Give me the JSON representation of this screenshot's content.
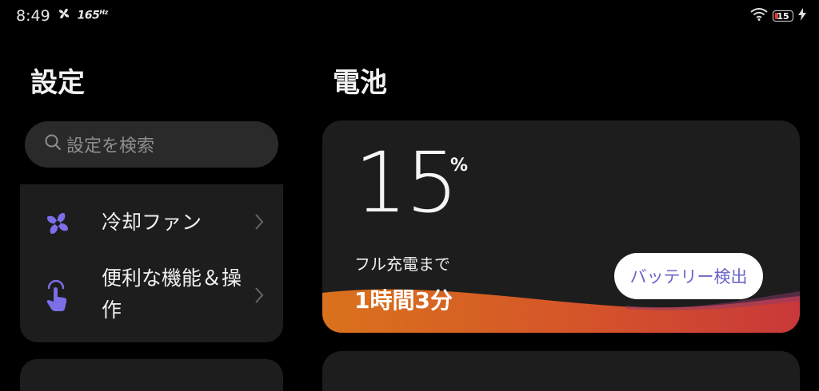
{
  "status_bar": {
    "time": "8:49",
    "refresh_rate": "165",
    "refresh_rate_unit": "Hz",
    "battery_level": "15"
  },
  "settings_pane": {
    "title": "設定",
    "search_placeholder": "設定を検索",
    "items": [
      {
        "label": "冷却ファン",
        "icon": "fan-icon"
      },
      {
        "label": "便利な機能＆操作",
        "icon": "tap-gesture-icon"
      }
    ]
  },
  "battery_pane": {
    "title": "電池",
    "level": "15",
    "unit": "%",
    "charge_label": "フル充電まで",
    "charge_time": "1時間3分",
    "check_button": "バッテリー検出"
  },
  "colors": {
    "background": "#000000",
    "card": "#1d1d1d",
    "search": "#2a2a2a",
    "accent_purple": "#7b6ee6",
    "button_text": "#6a64c9",
    "battery_red": "#e53935"
  }
}
